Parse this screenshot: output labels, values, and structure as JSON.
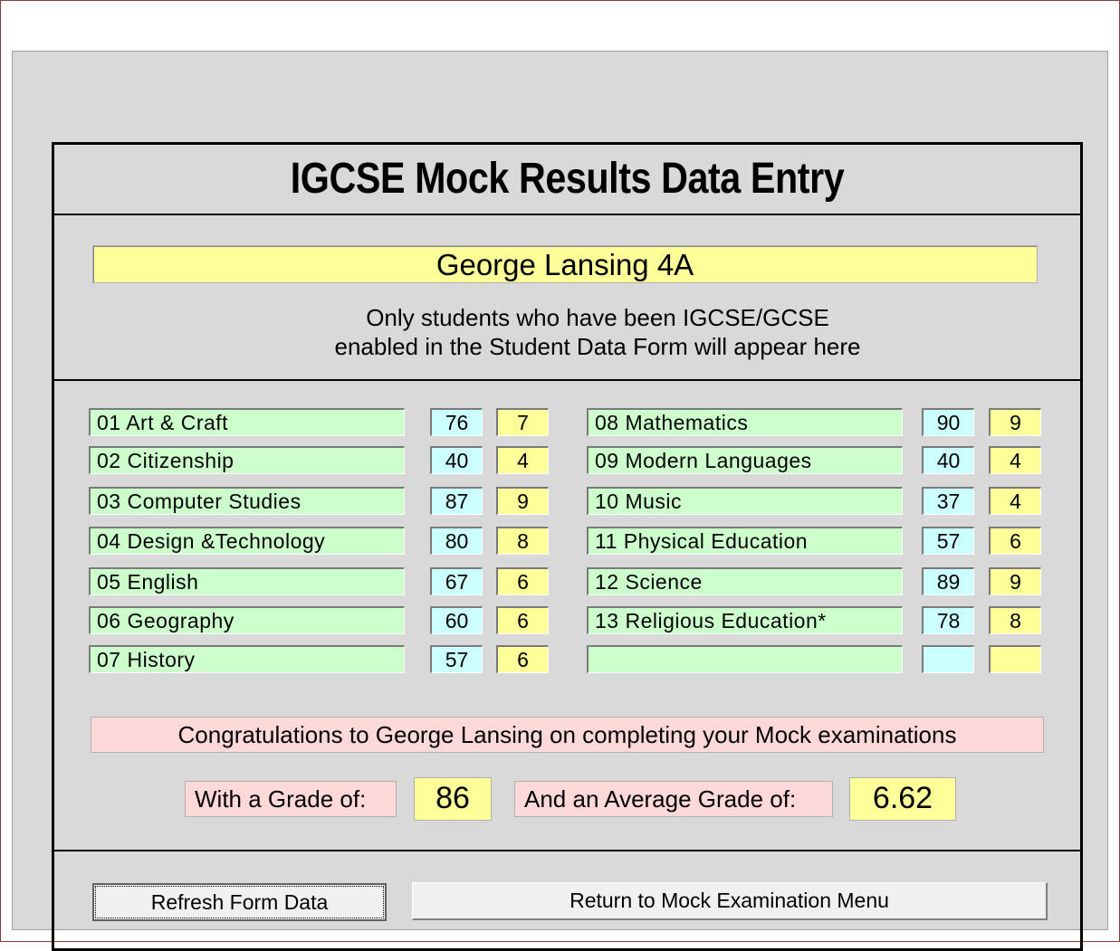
{
  "form": {
    "title": "IGCSE Mock Results Data Entry",
    "student_name": "George Lansing 4A",
    "notice_line1": "Only students who have been IGCSE/GCSE",
    "notice_line2": "enabled in the Student Data Form will appear here"
  },
  "subjects_left": [
    {
      "subject": "01 Art & Craft",
      "mark": "76",
      "grade": "7"
    },
    {
      "subject": "02 Citizenship",
      "mark": "40",
      "grade": "4"
    },
    {
      "subject": "03 Computer Studies",
      "mark": "87",
      "grade": "9"
    },
    {
      "subject": "04 Design &Technology",
      "mark": "80",
      "grade": "8"
    },
    {
      "subject": "05 English",
      "mark": "67",
      "grade": "6"
    },
    {
      "subject": "06 Geography",
      "mark": "60",
      "grade": "6"
    },
    {
      "subject": "07 History",
      "mark": "57",
      "grade": "6"
    }
  ],
  "subjects_right": [
    {
      "subject": "08 Mathematics",
      "mark": "90",
      "grade": "9"
    },
    {
      "subject": "09 Modern Languages",
      "mark": "40",
      "grade": "4"
    },
    {
      "subject": "10 Music",
      "mark": "37",
      "grade": "4"
    },
    {
      "subject": "11 Physical Education",
      "mark": "57",
      "grade": "6"
    },
    {
      "subject": "12 Science",
      "mark": "89",
      "grade": "9"
    },
    {
      "subject": "13 Religious Education*",
      "mark": "78",
      "grade": "8"
    },
    {
      "subject": "",
      "mark": "",
      "grade": ""
    }
  ],
  "summary": {
    "congratulations": "Congratulations to George Lansing on completing your Mock examinations",
    "grade_label": "With a Grade of:",
    "grade_value": "86",
    "average_label": "And an Average Grade of:",
    "average_value": "6.62"
  },
  "buttons": {
    "refresh_label": "Refresh Form Data",
    "return_label": "Return to Mock Examination Menu"
  },
  "colors": {
    "subject_bg": "#ccffcc",
    "mark_bg": "#ccffff",
    "grade_bg": "#ffff99",
    "summary_bg": "#ffd9d9"
  }
}
